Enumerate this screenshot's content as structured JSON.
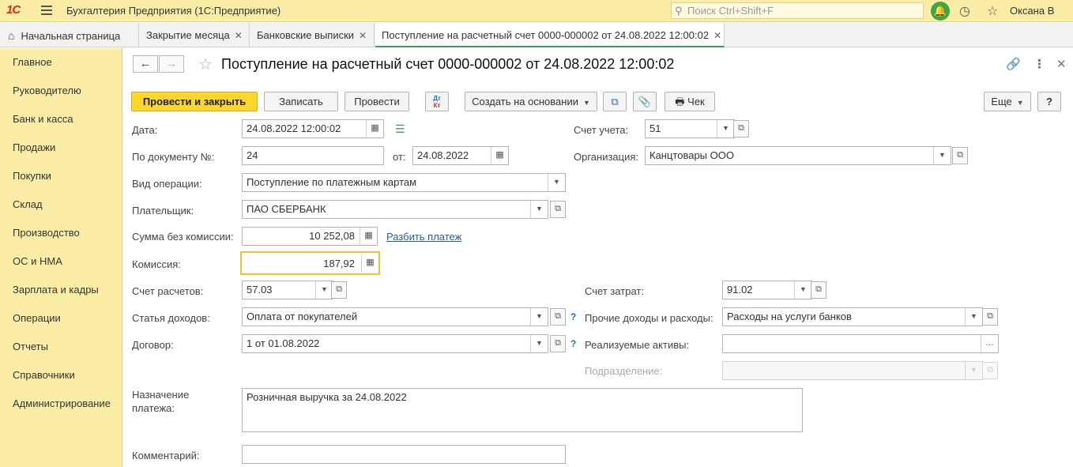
{
  "titlebar": {
    "logo": "1С",
    "app_title": "Бухгалтерия Предприятия  (1С:Предприятие)",
    "search_placeholder": "Поиск Ctrl+Shift+F",
    "user": "Оксана В"
  },
  "tabs": [
    {
      "label": "Начальная страница"
    },
    {
      "label": "Закрытие месяца"
    },
    {
      "label": "Банковские выписки"
    },
    {
      "label": "Поступление на расчетный счет 0000-000002 от 24.08.2022 12:00:02"
    }
  ],
  "sidebar": {
    "items": [
      {
        "label": "Главное"
      },
      {
        "label": "Руководителю"
      },
      {
        "label": "Банк и касса"
      },
      {
        "label": "Продажи"
      },
      {
        "label": "Покупки"
      },
      {
        "label": "Склад"
      },
      {
        "label": "Производство"
      },
      {
        "label": "ОС и НМА"
      },
      {
        "label": "Зарплата и кадры"
      },
      {
        "label": "Операции"
      },
      {
        "label": "Отчеты"
      },
      {
        "label": "Справочники"
      },
      {
        "label": "Администрирование"
      }
    ]
  },
  "document": {
    "title": "Поступление на расчетный счет 0000-000002 от 24.08.2022 12:00:02"
  },
  "toolbar": {
    "post_close": "Провести и закрыть",
    "save": "Записать",
    "post": "Провести",
    "dt": "Дт",
    "kt": "Кт",
    "create_based": "Создать на основании",
    "receipt": "Чек",
    "more": "Еще",
    "help": "?"
  },
  "form": {
    "date_label": "Дата:",
    "date_value": "24.08.2022 12:00:02",
    "doc_no_label": "По документу №:",
    "doc_no_value": "24",
    "from_label": "от:",
    "from_value": "24.08.2022",
    "op_type_label": "Вид операции:",
    "op_type_value": "Поступление по платежным картам",
    "payer_label": "Плательщик:",
    "payer_value": "ПАО СБЕРБАНК",
    "sum_label": "Сумма без комиссии:",
    "sum_value": "10 252,08",
    "split_link": "Разбить платеж",
    "commission_label": "Комиссия:",
    "commission_value": "187,92",
    "settle_acc_label": "Счет расчетов:",
    "settle_acc_value": "57.03",
    "income_item_label": "Статья доходов:",
    "income_item_value": "Оплата от покупателей",
    "contract_label": "Договор:",
    "contract_value": "1 от 01.08.2022",
    "purpose_label_1": "Назначение",
    "purpose_label_2": "платежа:",
    "purpose_value": "Розничная выручка за 24.08.2022",
    "comment_label": "Комментарий:",
    "comment_value": "",
    "account_label": "Счет учета:",
    "account_value": "51",
    "org_label": "Организация:",
    "org_value": "Канцтовары ООО",
    "cost_acc_label": "Счет затрат:",
    "cost_acc_value": "91.02",
    "other_ie_label": "Прочие доходы и расходы:",
    "other_ie_value": "Расходы на услуги банков",
    "assets_label": "Реализуемые активы:",
    "assets_value": "",
    "division_label": "Подразделение:",
    "division_value": "",
    "qmark": "?"
  }
}
